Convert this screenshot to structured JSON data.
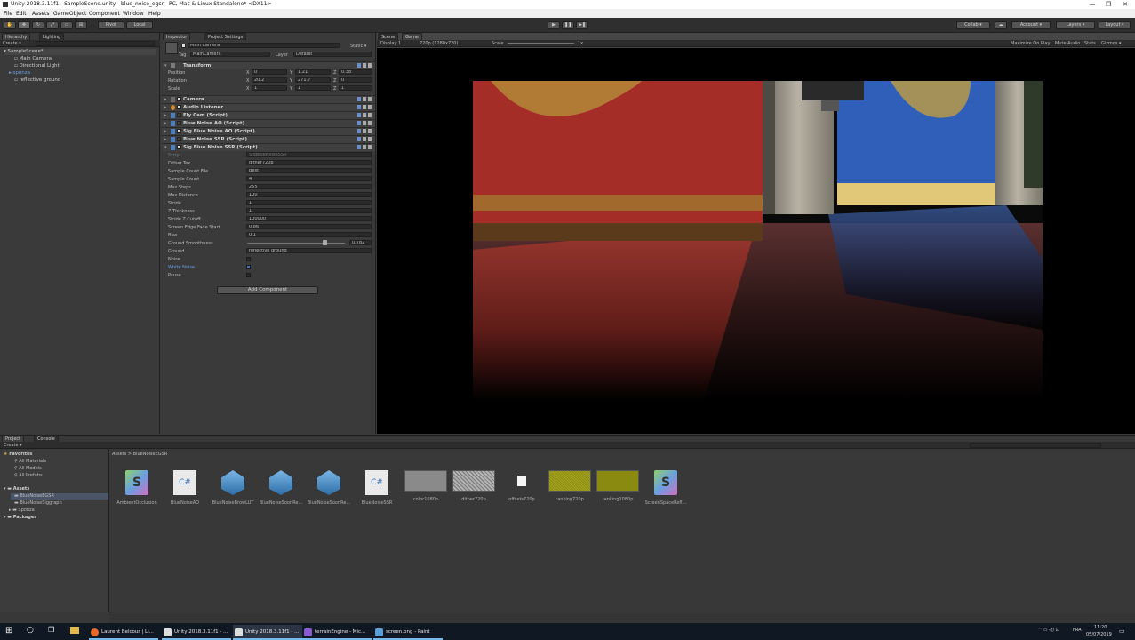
{
  "window": {
    "title": "Unity 2018.3.11f1 - SampleScene.unity - blue_noise_egsr - PC, Mac & Linux Standalone* <DX11>",
    "controls": [
      "—",
      "❐",
      "✕"
    ]
  },
  "menu": [
    "File",
    "Edit",
    "Assets",
    "GameObject",
    "Component",
    "Window",
    "Help"
  ],
  "toolbar": {
    "pivot": "Pivot",
    "local": "Local",
    "collab": "Collab ▾",
    "account": "Account ▾",
    "layers": "Layers ▾",
    "layout": "Layout ▾"
  },
  "hierarchy": {
    "tabs": [
      "Hierarchy",
      "Lighting"
    ],
    "create": "Create ▾",
    "search": "",
    "scene": "SampleScene*",
    "items": [
      "Main Camera",
      "Directional Light",
      "sponza",
      "reflective ground"
    ]
  },
  "inspector": {
    "tabs": [
      "Inspector",
      "Project Settings"
    ],
    "object_name": "Main Camera",
    "static": "Static ▾",
    "tag_label": "Tag",
    "tag_value": "MainCamera",
    "layer_label": "Layer",
    "layer_value": "Default",
    "transform": {
      "name": "Transform",
      "rows": [
        {
          "label": "Position",
          "x": "0",
          "y": "1.21",
          "z": "0.38"
        },
        {
          "label": "Rotation",
          "x": "20.2",
          "y": "271.7",
          "z": "0"
        },
        {
          "label": "Scale",
          "x": "1",
          "y": "1",
          "z": "1"
        }
      ]
    },
    "components": [
      "Camera",
      "Audio Listener",
      "Fly Cam (Script)",
      "Blue Noise AO (Script)",
      "Sig Blue Noise AO (Script)",
      "Blue Noise SSR (Script)",
      "Sig Blue Noise SSR (Script)"
    ],
    "script_label": "Script",
    "script_value": "SigBlueNoiseSSR",
    "properties": [
      {
        "label": "Dither Tex",
        "value": "dither720p"
      },
      {
        "label": "Sample Count File",
        "value": "Best"
      },
      {
        "label": "Sample Count",
        "value": "4"
      },
      {
        "label": "Max Steps",
        "value": "255"
      },
      {
        "label": "Max Distance",
        "value": "100"
      },
      {
        "label": "Stride",
        "value": "1"
      },
      {
        "label": "Z Thickness",
        "value": "1"
      },
      {
        "label": "Stride Z Cutoff",
        "value": "100000"
      },
      {
        "label": "Screen Edge Fade Start",
        "value": "0.86"
      },
      {
        "label": "Bias",
        "value": "0.1"
      },
      {
        "label": "Ground Smoothness",
        "value": "0.782"
      },
      {
        "label": "Ground",
        "value": "reflective ground"
      }
    ],
    "checkboxes": [
      {
        "label": "Noise",
        "checked": false
      },
      {
        "label": "White Noise",
        "checked": true
      },
      {
        "label": "Pause",
        "checked": false
      }
    ],
    "add_component": "Add Component"
  },
  "scene_tabs": [
    "Scene",
    "Game"
  ],
  "game_bar": {
    "display": "Display 1",
    "resolution": "720p (1280x720)",
    "scale_label": "Scale",
    "scale_value": "1x",
    "maximize": "Maximize On Play",
    "mute": "Mute Audio",
    "stats": "Stats",
    "gizmos": "Gizmos ▾"
  },
  "project": {
    "tabs": [
      "Project",
      "Console"
    ],
    "create": "Create ▾",
    "breadcrumb": "Assets > BlueNoiseEGSR",
    "favorites_label": "Favorites",
    "favorites": [
      "All Materials",
      "All Models",
      "All Prefabs"
    ],
    "assets_label": "Assets",
    "assets_tree": [
      "BlueNoiseEGSR",
      "BlueNoiseSiggraph",
      "Sponza"
    ],
    "packages_label": "Packages",
    "files": [
      "AmbientOcclusion",
      "BlueNoiseAO",
      "BlueNoiseBrowLUT",
      "BlueNoiseSoonRe...",
      "BlueNoiseSoonRe...",
      "BlueNoiseSSR",
      "color1080p",
      "dither720p",
      "offsets720p",
      "ranking720p",
      "ranking1080p",
      "ScreenSpaceRefl..."
    ]
  },
  "taskbar": {
    "items": [
      "Laurent Belcour | Li...",
      "Unity 2018.3.11f1 - ...",
      "Unity 2018.3.11f1 - ...",
      "terrainEngine - Mic...",
      "screen.png - Paint"
    ],
    "time": "11:20",
    "date": "05/07/2019",
    "lang": "FRA"
  }
}
